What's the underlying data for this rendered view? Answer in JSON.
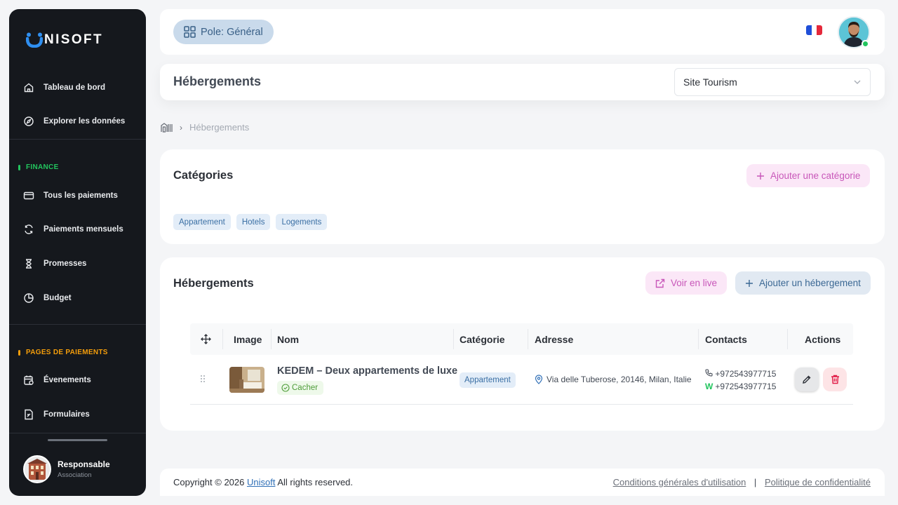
{
  "sidebar": {
    "brand": "NISOFT",
    "nav_top": [
      {
        "label": "Tableau de bord",
        "icon": "home-icon"
      },
      {
        "label": "Explorer les données",
        "icon": "compass-icon"
      }
    ],
    "sections": [
      {
        "title": "FINANCE",
        "color": "#22c55e",
        "items": [
          {
            "label": "Tous les paiements",
            "icon": "credit-card-icon"
          },
          {
            "label": "Paiements mensuels",
            "icon": "refresh-icon"
          },
          {
            "label": "Promesses",
            "icon": "hourglass-icon"
          },
          {
            "label": "Budget",
            "icon": "pie-chart-icon"
          }
        ]
      },
      {
        "title": "PAGES DE PAIEMENTS",
        "color": "#f59e0b",
        "items": [
          {
            "label": "Évenements",
            "icon": "calendar-icon"
          },
          {
            "label": "Formulaires",
            "icon": "form-icon"
          }
        ]
      }
    ],
    "user": {
      "name": "Responsable",
      "role": "Association"
    }
  },
  "topbar": {
    "pole_label": "Pole: Général",
    "flag": "fr-flag"
  },
  "header": {
    "title": "Hébergements",
    "site_select_value": "Site Tourism"
  },
  "breadcrumb": {
    "current": "Hébergements"
  },
  "categories_card": {
    "title": "Catégories",
    "add_button": "Ajouter une catégorie",
    "chips": [
      "Appartement",
      "Hotels",
      "Logements"
    ]
  },
  "hebergements_card": {
    "title": "Hébergements",
    "live_button": "Voir en live",
    "add_button": "Ajouter un hébergement",
    "columns": [
      "Image",
      "Nom",
      "Catégorie",
      "Adresse",
      "Contacts",
      "Actions"
    ],
    "rows": [
      {
        "name": "KEDEM – Deux appartements de luxe",
        "status": "Cacher",
        "category": "Appartement",
        "address": "Via delle Tuberose, 20146, Milan, Italie",
        "phone": "+972543977715",
        "whatsapp_prefix": "W",
        "whatsapp": "+972543977715"
      }
    ]
  },
  "footer": {
    "copyright": "Copyright © 2026",
    "brand_link": "Unisoft",
    "rights": "All rights reserved.",
    "terms": "Conditions générales d'utilisation",
    "separator": "|",
    "privacy": "Politique de confidentialité"
  },
  "colors": {
    "sidebar_bg": "#15181d",
    "accent_blue": "#3b6894",
    "accent_pink": "#c857b9",
    "danger": "#e11d48",
    "success": "#22c55e"
  }
}
